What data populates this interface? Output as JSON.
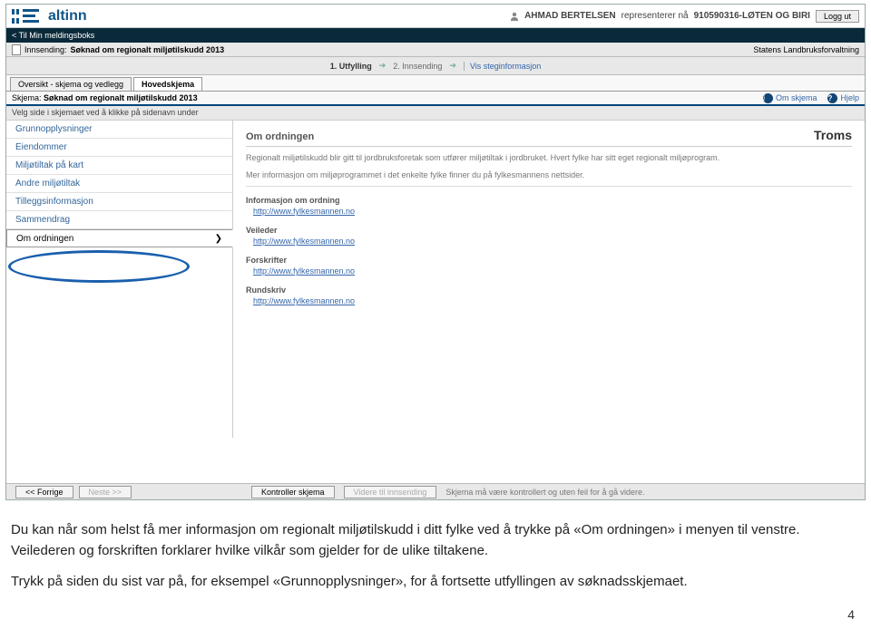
{
  "header": {
    "logo_text": "altinn",
    "user_prefix": "AHMAD BERTELSEN",
    "user_rep": "representerer nå",
    "user_org": "910590316-LØTEN OG BIRI",
    "logout": "Logg ut"
  },
  "bar_black": "< Til Min meldingsboks",
  "innsending": {
    "label": "Innsending:",
    "title": "Søknad om regionalt miljøtilskudd 2013",
    "org": "Statens Landbruksforvaltning"
  },
  "steps": {
    "s1": "1. Utfylling",
    "s2": "2. Innsending",
    "link": "Vis steginformasjon"
  },
  "tabs": {
    "t1": "Oversikt - skjema og vedlegg",
    "t2": "Hovedskjema"
  },
  "skjema_row": {
    "label": "Skjema:",
    "value": "Søknad om regionalt miljøtilskudd 2013",
    "om": "Om skjema",
    "hjelp": "Hjelp"
  },
  "velg": "Velg side i skjemaet ved å klikke på sidenavn under",
  "sidebar": {
    "items": [
      "Grunnopplysninger",
      "Eiendommer",
      "Miljøtiltak på kart",
      "Andre miljøtiltak",
      "Tilleggsinformasjon",
      "Sammendrag",
      "Om ordningen"
    ]
  },
  "content": {
    "title": "Om ordningen",
    "region": "Troms",
    "p1": "Regionalt miljøtilskudd blir gitt til jordbruksforetak som utfører miljøtiltak i jordbruket. Hvert fylke har sitt eget regionalt miljøprogram.",
    "p2": "Mer informasjon om miljøprogrammet i det enkelte fylke finner du på fylkesmannens nettsider.",
    "sec1": "Informasjon om ordning",
    "sec2": "Veileder",
    "sec3": "Forskrifter",
    "sec4": "Rundskriv",
    "link": "http://www.fylkesmannen.no"
  },
  "bottom": {
    "prev": "<< Forrige",
    "next": "Neste >>",
    "kontroll": "Kontroller skjema",
    "videre": "Videre til innsending",
    "msg": "Skjema må være kontrollert og uten feil for å gå videre."
  },
  "notes": {
    "p1": "Du kan når som helst få mer informasjon om regionalt miljøtilskudd i ditt fylke ved å trykke på «Om ordningen» i menyen til venstre. Veilederen og forskriften forklarer hvilke vilkår som gjelder for de ulike tiltakene.",
    "p2": "Trykk på siden du sist var på, for eksempel «Grunnopplysninger», for å fortsette utfyllingen av søknadsskjemaet."
  },
  "page_number": "4"
}
